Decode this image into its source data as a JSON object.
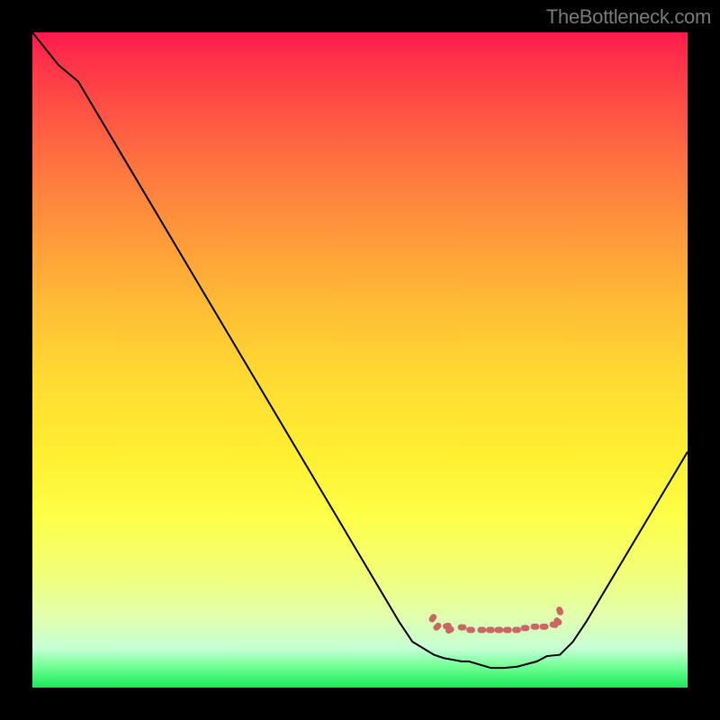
{
  "watermark": "TheBottleneck.com",
  "chart_data": {
    "type": "line",
    "title": "",
    "xlabel": "",
    "ylabel": "",
    "xlim": [
      0,
      100
    ],
    "ylim": [
      0,
      100
    ],
    "series": [
      {
        "name": "curve",
        "points": [
          {
            "x": 0,
            "y": 100
          },
          {
            "x": 4,
            "y": 95
          },
          {
            "x": 7,
            "y": 92.5
          },
          {
            "x": 56,
            "y": 10
          },
          {
            "x": 58,
            "y": 7
          },
          {
            "x": 61.3,
            "y": 5
          },
          {
            "x": 62.8,
            "y": 4.5
          },
          {
            "x": 65.5,
            "y": 4
          },
          {
            "x": 66.6,
            "y": 4
          },
          {
            "x": 70,
            "y": 3
          },
          {
            "x": 72,
            "y": 3
          },
          {
            "x": 74,
            "y": 3.2
          },
          {
            "x": 77,
            "y": 4
          },
          {
            "x": 78.5,
            "y": 4.8
          },
          {
            "x": 80.5,
            "y": 5
          },
          {
            "x": 82.5,
            "y": 7
          },
          {
            "x": 84.5,
            "y": 10
          },
          {
            "x": 100,
            "y": 36
          }
        ]
      },
      {
        "name": "marker-dashes",
        "points": [
          {
            "x": 61.1,
            "y": 10.6
          },
          {
            "x": 61.8,
            "y": 9.3
          },
          {
            "x": 63.3,
            "y": 9.4
          },
          {
            "x": 63.7,
            "y": 8.8
          },
          {
            "x": 65.6,
            "y": 9.2
          },
          {
            "x": 66.9,
            "y": 8.8
          },
          {
            "x": 68.6,
            "y": 8.8
          },
          {
            "x": 69.9,
            "y": 8.8
          },
          {
            "x": 71.2,
            "y": 8.8
          },
          {
            "x": 72.5,
            "y": 8.8
          },
          {
            "x": 73.9,
            "y": 8.8
          },
          {
            "x": 75.2,
            "y": 9.1
          },
          {
            "x": 76.7,
            "y": 9.3
          },
          {
            "x": 78.1,
            "y": 9.3
          },
          {
            "x": 79.6,
            "y": 9.6
          },
          {
            "x": 80.2,
            "y": 10.1
          },
          {
            "x": 80.5,
            "y": 11.7
          }
        ]
      }
    ],
    "colors": {
      "curve": "#000000",
      "marker": "#cc6666"
    }
  }
}
